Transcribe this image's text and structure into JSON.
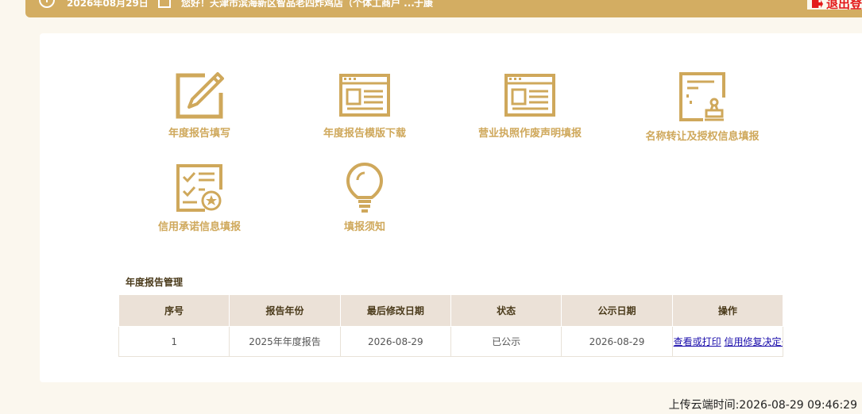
{
  "header": {
    "date": "2026年08月29日",
    "greeting": "您好！天津市滨海新区智品老四炸鸡店（个体工商户 ...",
    "user": "于康",
    "logout_label": "退出登"
  },
  "tiles": [
    {
      "label": "年度报告填写",
      "icon": "pencil-edit-icon"
    },
    {
      "label": "年度报告模版下载",
      "icon": "document-template-icon"
    },
    {
      "label": "营业执照作废声明填报",
      "icon": "document-template-icon"
    },
    {
      "label": "名称转让及授权信息填报",
      "icon": "stamp-document-icon"
    },
    {
      "label": "信用承诺信息填报",
      "icon": "checklist-badge-icon"
    },
    {
      "label": "填报须知",
      "icon": "lightbulb-icon"
    }
  ],
  "section": {
    "title": "年度报告管理"
  },
  "table": {
    "headers": [
      "序号",
      "报告年份",
      "最后修改日期",
      "状态",
      "公示日期",
      "操作"
    ],
    "rows": [
      {
        "index": "1",
        "year": "2025年年度报告",
        "modified": "2026-08-29",
        "status": "已公示",
        "published": "2026-08-29",
        "actions": [
          "查看或打印",
          "信用修复决定书"
        ]
      }
    ]
  },
  "footer": {
    "upload_time": "上传云端时间:2026-08-29 09:46:29"
  },
  "colors": {
    "accent": "#d3ad62",
    "icon": "#cfa85b",
    "logout": "#e31b1b",
    "header_bg": "#ebe1d7"
  }
}
